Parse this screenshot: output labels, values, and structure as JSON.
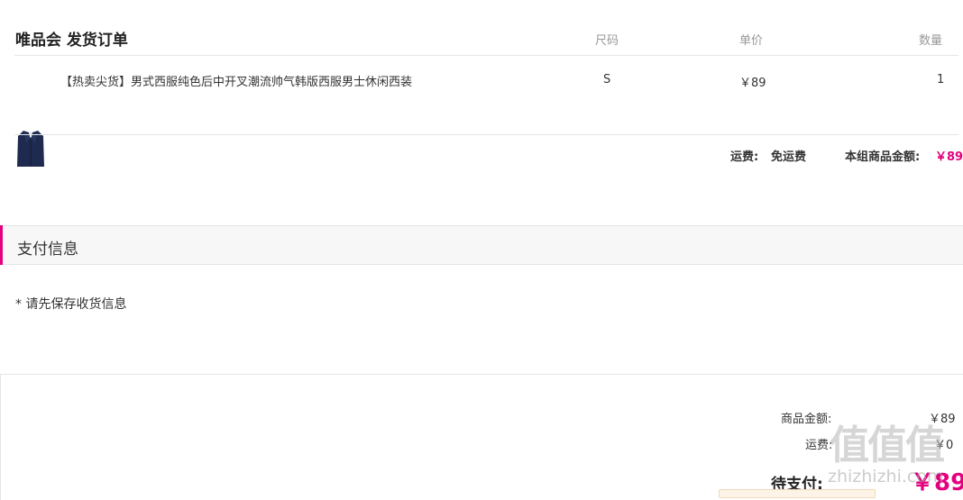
{
  "order": {
    "title": "唯品会 发货订单",
    "columns": {
      "size": "尺码",
      "price": "单价",
      "qty": "数量"
    },
    "items": [
      {
        "name": "【热卖尖货】男式西服纯色后中开叉潮流帅气韩版西服男士休闲西装",
        "size": "S",
        "price": "￥89",
        "qty": "1"
      }
    ],
    "shipping_label": "运费:",
    "shipping_value": "免运费",
    "group_total_label": "本组商品金额:",
    "group_total_value": "￥89"
  },
  "payment": {
    "title": "支付信息",
    "notice": "* 请先保存收货信息"
  },
  "summary": {
    "goods_label": "商品金额:",
    "goods_value": "￥89",
    "shipping_label": "运费:",
    "shipping_value": "￥0",
    "due_label": "待支付:",
    "due_value": "￥89"
  },
  "watermark": {
    "logo": "值值值",
    "url": "zhizhizhi.com"
  },
  "colors": {
    "accent": "#e4007f",
    "border": "#e5e5e5",
    "muted": "#999999"
  }
}
